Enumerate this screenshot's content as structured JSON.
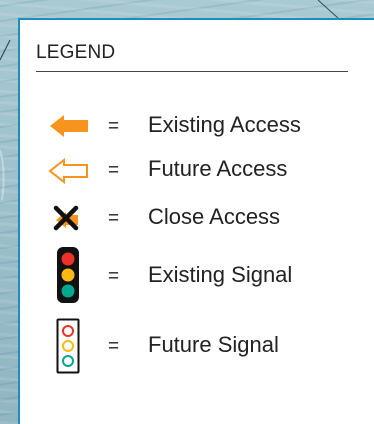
{
  "legend": {
    "title": "LEGEND",
    "equals": "=",
    "items": [
      {
        "icon": "existing-access-arrow-icon",
        "label": "Existing Access"
      },
      {
        "icon": "future-access-arrow-icon",
        "label": "Future Access"
      },
      {
        "icon": "close-access-x-icon",
        "label": "Close Access"
      },
      {
        "icon": "existing-signal-icon",
        "label": "Existing Signal"
      },
      {
        "icon": "future-signal-icon",
        "label": "Future Signal"
      }
    ]
  },
  "colors": {
    "panel_border": "#1d8fbf",
    "access_orange": "#f7941d",
    "signal_red": "#ee3124",
    "signal_yellow": "#fdb913",
    "signal_green": "#00a88f"
  }
}
